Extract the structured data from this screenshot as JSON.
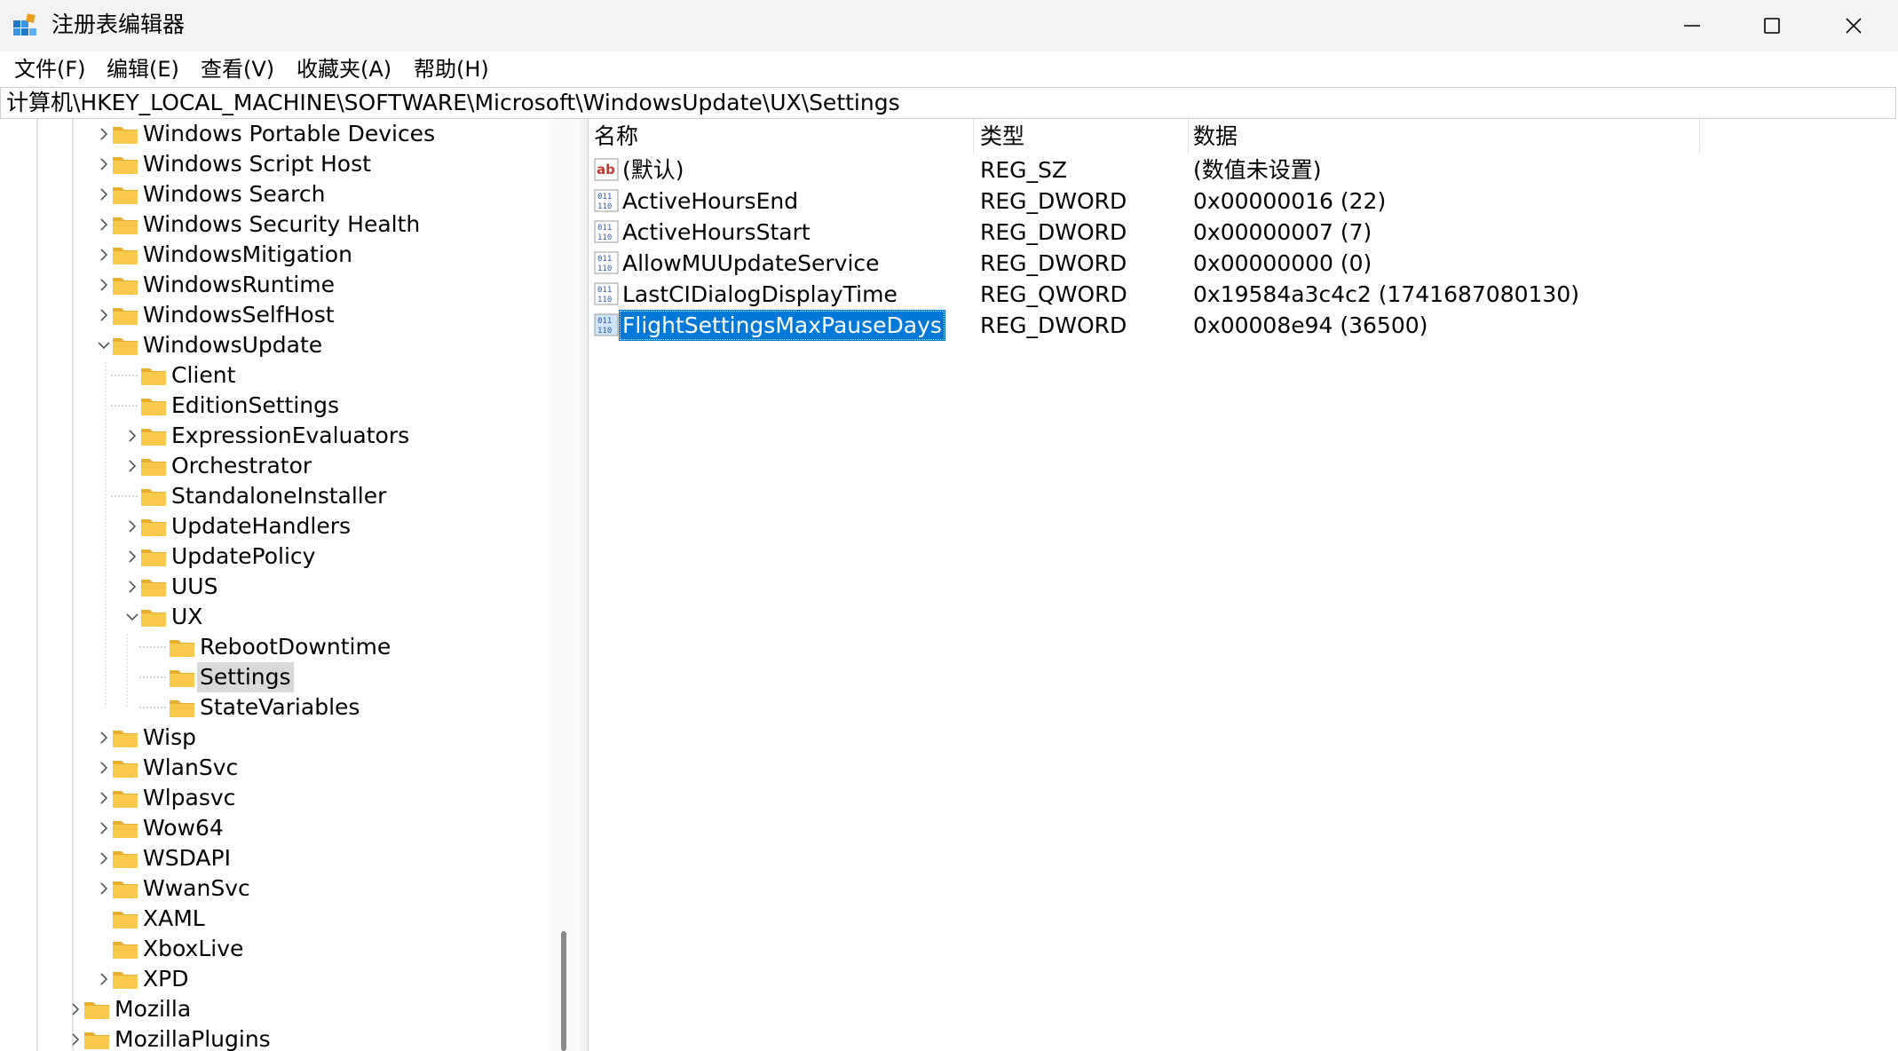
{
  "window": {
    "title": "注册表编辑器"
  },
  "menu": [
    "文件(F)",
    "编辑(E)",
    "查看(V)",
    "收藏夹(A)",
    "帮助(H)"
  ],
  "address": "计算机\\HKEY_LOCAL_MACHINE\\SOFTWARE\\Microsoft\\WindowsUpdate\\UX\\Settings",
  "tree": [
    {
      "label": "Windows Portable Devices",
      "level": 2,
      "expander": "collapsed"
    },
    {
      "label": "Windows Script Host",
      "level": 2,
      "expander": "collapsed"
    },
    {
      "label": "Windows Search",
      "level": 2,
      "expander": "collapsed"
    },
    {
      "label": "Windows Security Health",
      "level": 2,
      "expander": "collapsed"
    },
    {
      "label": "WindowsMitigation",
      "level": 2,
      "expander": "collapsed"
    },
    {
      "label": "WindowsRuntime",
      "level": 2,
      "expander": "collapsed"
    },
    {
      "label": "WindowsSelfHost",
      "level": 2,
      "expander": "collapsed"
    },
    {
      "label": "WindowsUpdate",
      "level": 2,
      "expander": "expanded"
    },
    {
      "label": "Client",
      "level": 3,
      "expander": "none"
    },
    {
      "label": "EditionSettings",
      "level": 3,
      "expander": "none"
    },
    {
      "label": "ExpressionEvaluators",
      "level": 3,
      "expander": "collapsed"
    },
    {
      "label": "Orchestrator",
      "level": 3,
      "expander": "collapsed"
    },
    {
      "label": "StandaloneInstaller",
      "level": 3,
      "expander": "none"
    },
    {
      "label": "UpdateHandlers",
      "level": 3,
      "expander": "collapsed"
    },
    {
      "label": "UpdatePolicy",
      "level": 3,
      "expander": "collapsed"
    },
    {
      "label": "UUS",
      "level": 3,
      "expander": "collapsed"
    },
    {
      "label": "UX",
      "level": 3,
      "expander": "expanded"
    },
    {
      "label": "RebootDowntime",
      "level": 4,
      "expander": "none"
    },
    {
      "label": "Settings",
      "level": 4,
      "expander": "none",
      "selected": true
    },
    {
      "label": "StateVariables",
      "level": 4,
      "expander": "none"
    },
    {
      "label": "Wisp",
      "level": 2,
      "expander": "collapsed"
    },
    {
      "label": "WlanSvc",
      "level": 2,
      "expander": "collapsed"
    },
    {
      "label": "Wlpasvc",
      "level": 2,
      "expander": "collapsed"
    },
    {
      "label": "Wow64",
      "level": 2,
      "expander": "collapsed"
    },
    {
      "label": "WSDAPI",
      "level": 2,
      "expander": "collapsed"
    },
    {
      "label": "WwanSvc",
      "level": 2,
      "expander": "collapsed"
    },
    {
      "label": "XAML",
      "level": 2,
      "expander": "none"
    },
    {
      "label": "XboxLive",
      "level": 2,
      "expander": "none"
    },
    {
      "label": "XPD",
      "level": 2,
      "expander": "collapsed"
    },
    {
      "label": "Mozilla",
      "level": 1,
      "expander": "collapsed"
    },
    {
      "label": "MozillaPlugins",
      "level": 1,
      "expander": "collapsed"
    }
  ],
  "values_header": {
    "name": "名称",
    "type": "类型",
    "data": "数据"
  },
  "values": [
    {
      "icon": "string-value-icon",
      "name": "(默认)",
      "type": "REG_SZ",
      "data": "(数值未设置)"
    },
    {
      "icon": "binary-value-icon",
      "name": "ActiveHoursEnd",
      "type": "REG_DWORD",
      "data": "0x00000016 (22)"
    },
    {
      "icon": "binary-value-icon",
      "name": "ActiveHoursStart",
      "type": "REG_DWORD",
      "data": "0x00000007 (7)"
    },
    {
      "icon": "binary-value-icon",
      "name": "AllowMUUpdateService",
      "type": "REG_DWORD",
      "data": "0x00000000 (0)"
    },
    {
      "icon": "binary-value-icon",
      "name": "LastCIDialogDisplayTime",
      "type": "REG_QWORD",
      "data": "0x19584a3c4c2 (1741687080130)"
    },
    {
      "icon": "binary-value-icon",
      "name": "FlightSettingsMaxPauseDays",
      "type": "REG_DWORD",
      "data": "0x00008e94 (36500)",
      "selected": true
    }
  ],
  "colors": {
    "selection": "#0078d7",
    "tree_selection": "#d9d9d9",
    "folder": "#f8c94a",
    "titlebar": "#f3f3f3"
  }
}
